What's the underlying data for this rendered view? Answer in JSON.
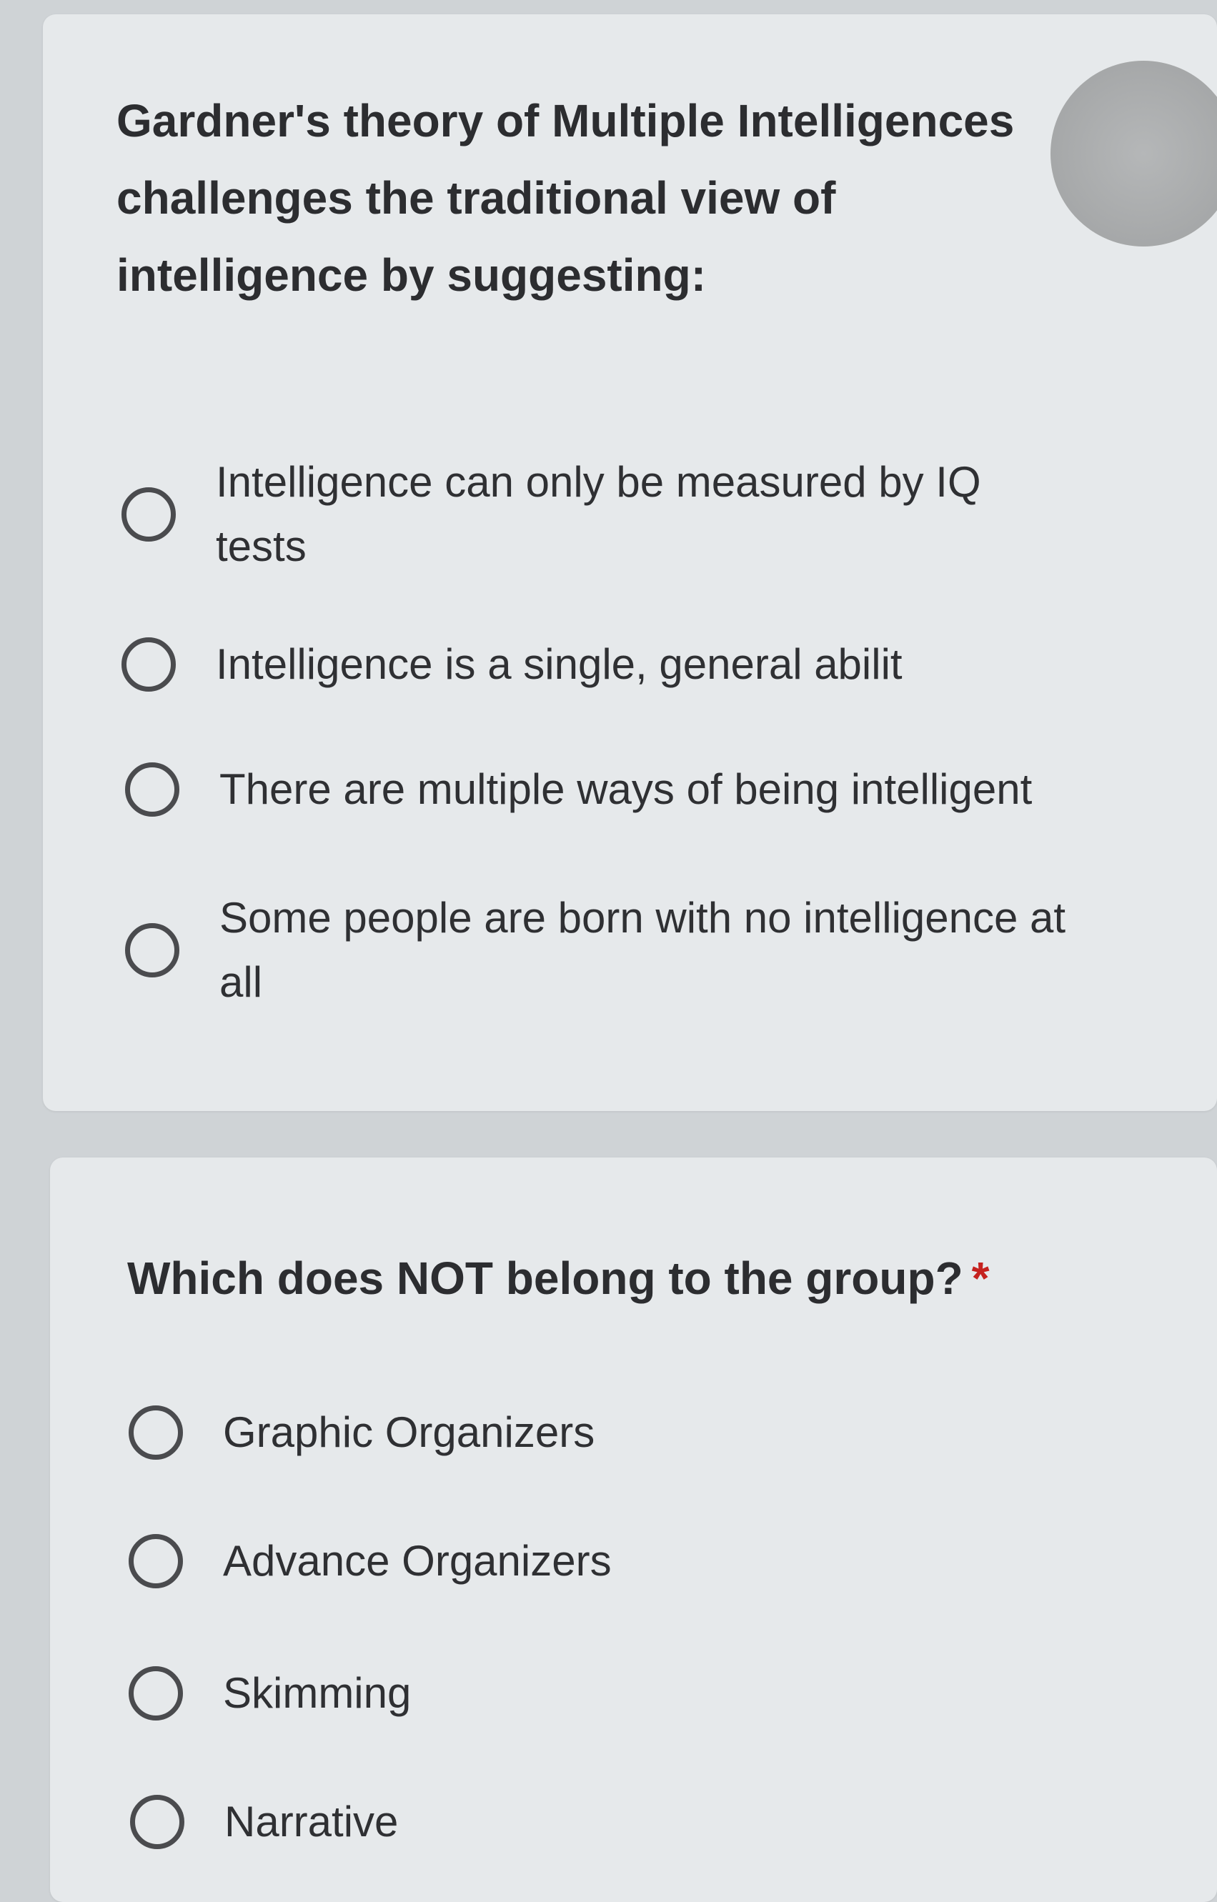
{
  "questions": [
    {
      "title": "Gardner's theory of Multiple Intelligences challenges the traditional view of intelligence by suggesting:",
      "required_mark": "*",
      "options": [
        "Intelligence can only be measured by IQ tests",
        "Intelligence is a single, general abilit",
        "There are multiple ways of being intelligent",
        "Some people are born with no intelligence at all"
      ]
    },
    {
      "title": "Which does NOT belong to the group?",
      "required_mark": "*",
      "options": [
        "Graphic Organizers",
        "Advance Organizers",
        "Skimming",
        "Narrative"
      ]
    }
  ],
  "colors": {
    "background": "#cfd3d6",
    "card": "#e6e9eb",
    "text": "#2f3033",
    "required": "#c5221f",
    "radio_border": "#4a4b4e"
  },
  "icons": {
    "radio": "radio-unchecked-icon",
    "avatar": "avatar-circle"
  }
}
